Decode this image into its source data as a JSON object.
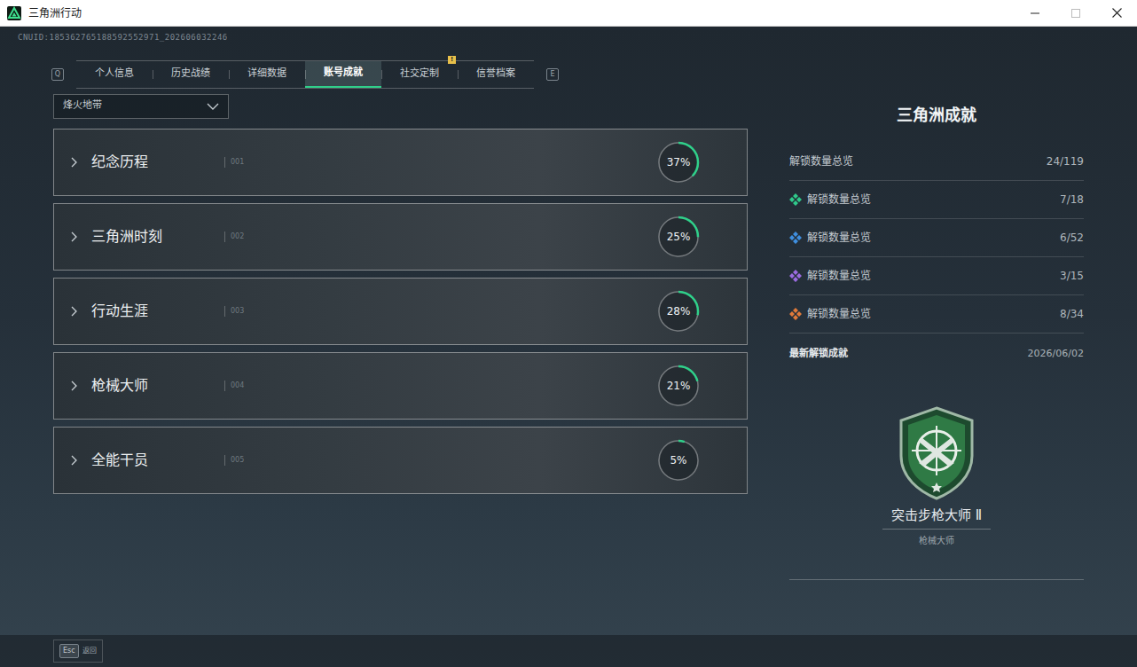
{
  "window": {
    "title": "三角洲行动"
  },
  "uid": "CNUID:185362765188592552971_202606032246",
  "tabs": {
    "prev_key": "Q",
    "next_key": "E",
    "items": [
      {
        "label": "个人信息",
        "selected": false
      },
      {
        "label": "历史战绩",
        "selected": false
      },
      {
        "label": "详细数据",
        "selected": false
      },
      {
        "label": "账号成就",
        "selected": true
      },
      {
        "label": "社交定制",
        "selected": false,
        "badge": "!"
      },
      {
        "label": "信誉档案",
        "selected": false
      }
    ]
  },
  "mode_select": {
    "value": "烽火地带"
  },
  "categories": [
    {
      "title": "纪念历程",
      "code": "001",
      "level": 0.37,
      "reading": "37%"
    },
    {
      "title": "三角洲时刻",
      "code": "002",
      "level": 0.25,
      "reading": "25%"
    },
    {
      "title": "行动生涯",
      "code": "003",
      "level": 0.28,
      "reading": "28%"
    },
    {
      "title": "枪械大师",
      "code": "004",
      "level": 0.21,
      "reading": "21%"
    },
    {
      "title": "全能干员",
      "code": "005",
      "level": 0.05,
      "reading": "5%"
    }
  ],
  "summary": {
    "title": "三角洲成就",
    "total": {
      "label": "解锁数量总览",
      "value": "24/119"
    },
    "rows": [
      {
        "label": "解锁数量总览",
        "value": "7/18",
        "color": "#2fc98a"
      },
      {
        "label": "解锁数量总览",
        "value": "6/52",
        "color": "#3f8fe0"
      },
      {
        "label": "解锁数量总览",
        "value": "3/15",
        "color": "#9b6be0"
      },
      {
        "label": "解锁数量总览",
        "value": "8/34",
        "color": "#e07a3a"
      }
    ]
  },
  "latest": {
    "label": "最新解锁成就",
    "date": "2026/06/02",
    "name": "突击步枪大师 Ⅱ",
    "category": "枪械大师"
  },
  "footer": {
    "key": "Esc",
    "label": "返回"
  }
}
